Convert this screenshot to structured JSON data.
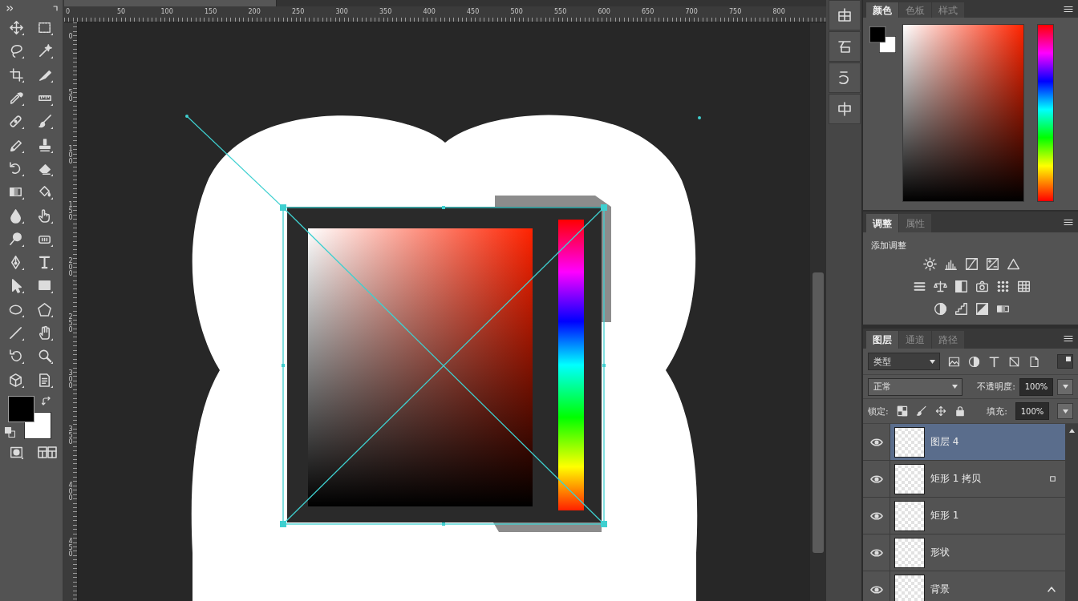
{
  "rulers": {
    "top_labels": [
      "0",
      "50",
      "100",
      "150",
      "200",
      "250",
      "300",
      "350",
      "400",
      "450",
      "500",
      "550",
      "600",
      "650",
      "700",
      "750",
      "800"
    ],
    "left_labels": [
      "0",
      "50",
      "100",
      "150",
      "200",
      "250",
      "300",
      "350",
      "400",
      "450"
    ]
  },
  "color_panel": {
    "tabs": [
      {
        "label": "颜色",
        "selected": true
      },
      {
        "label": "色板",
        "selected": false
      },
      {
        "label": "样式",
        "selected": false
      }
    ]
  },
  "adjustments_panel": {
    "tabs": [
      {
        "label": "调整",
        "selected": true
      },
      {
        "label": "属性",
        "selected": false
      }
    ],
    "heading": "添加调整"
  },
  "layers_panel": {
    "tabs": [
      {
        "label": "图层",
        "selected": true
      },
      {
        "label": "通道",
        "selected": false
      },
      {
        "label": "路径",
        "selected": false
      }
    ],
    "filter": {
      "value": "类型"
    },
    "blend_mode": {
      "value": "正常"
    },
    "opacity": {
      "label": "不透明度:",
      "value": "100%"
    },
    "lock": {
      "label": "锁定:"
    },
    "fill": {
      "label": "填充:",
      "value": "100%"
    },
    "layers": [
      {
        "name": "图层 4",
        "visible": true,
        "selected": true,
        "kind": "plain"
      },
      {
        "name": "矩形 1 拷贝",
        "visible": true,
        "selected": false,
        "kind": "badged"
      },
      {
        "name": "矩形 1",
        "visible": true,
        "selected": false,
        "kind": "plain"
      },
      {
        "name": "形状",
        "visible": true,
        "selected": false,
        "kind": "plain"
      },
      {
        "name": "背景",
        "visible": true,
        "selected": false,
        "kind": "locked"
      }
    ]
  }
}
